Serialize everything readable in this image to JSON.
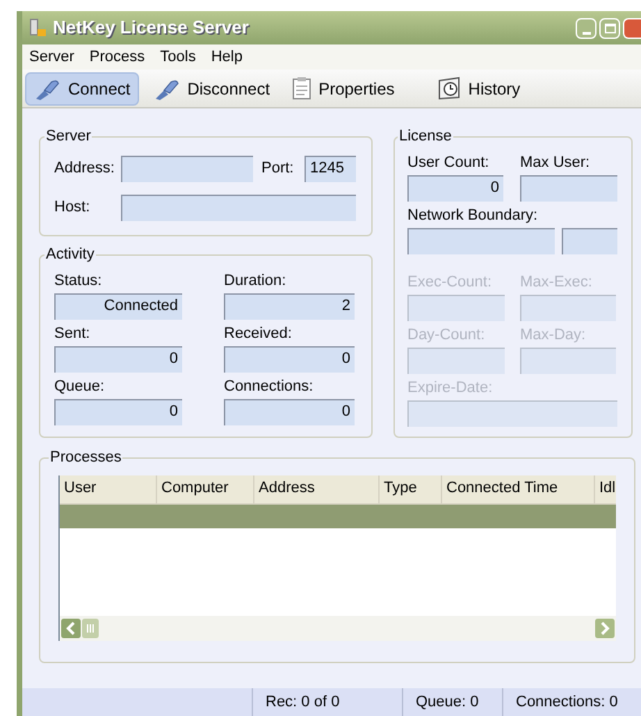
{
  "window": {
    "title": "NetKey License Server"
  },
  "menu": [
    "Server",
    "Process",
    "Tools",
    "Help"
  ],
  "toolbar": [
    {
      "label": "Connect",
      "selected": true
    },
    {
      "label": "Disconnect",
      "selected": false
    },
    {
      "label": "Properties",
      "selected": false
    },
    {
      "label": "History",
      "selected": false
    }
  ],
  "server": {
    "title": "Server",
    "fields": [
      {
        "label": "Address:"
      },
      {
        "label": "Port:",
        "value": "1245"
      },
      {
        "label": "Host:"
      }
    ]
  },
  "activity": {
    "title": "Activity",
    "fields": [
      {
        "label": "Status:",
        "value": "Connected"
      },
      {
        "label": "Duration:",
        "value": "2"
      },
      {
        "label": "Sent:",
        "value": "0"
      },
      {
        "label": "Received:",
        "value": "0"
      },
      {
        "label": "Queue:",
        "value": "0"
      },
      {
        "label": "Connections:",
        "value": "0"
      }
    ]
  },
  "license": {
    "title": "License",
    "fields": [
      {
        "label": "User Count:",
        "value": "0",
        "disabled": false
      },
      {
        "label": "Max User:",
        "disabled": false
      },
      {
        "label": "Network Boundary:",
        "disabled": false
      },
      {
        "label": "Exec-Count:",
        "disabled": true
      },
      {
        "label": "Max-Exec:",
        "disabled": true
      },
      {
        "label": "Day-Count:",
        "disabled": true
      },
      {
        "label": "Max-Day:",
        "disabled": true
      },
      {
        "label": "Expire-Date:",
        "disabled": true
      }
    ]
  },
  "processes": {
    "title": "Processes",
    "columns": [
      "User",
      "Computer",
      "Address",
      "Type",
      "Connected Time",
      "Idl"
    ],
    "rows": [
      {
        "selected": true
      }
    ]
  },
  "status_bar": [
    "Rec: 0 of 0",
    "Queue: 0",
    "Connections: 0"
  ]
}
